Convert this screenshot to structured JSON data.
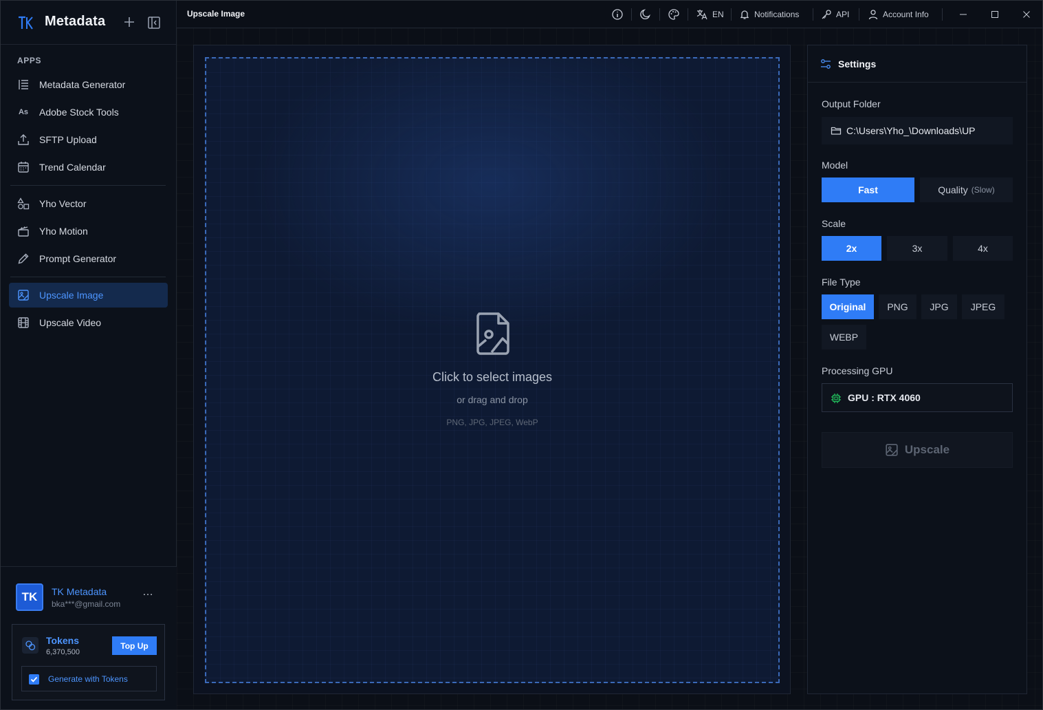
{
  "app": {
    "name": "Metadata",
    "page_title": "Upscale Image"
  },
  "sidebar": {
    "section_label": "APPS",
    "items": [
      {
        "label": "Metadata Generator",
        "icon": "list-icon"
      },
      {
        "label": "Adobe Stock Tools",
        "icon": "adobe-stock-icon",
        "icon_text": "As"
      },
      {
        "label": "SFTP Upload",
        "icon": "upload-icon"
      },
      {
        "label": "Trend Calendar",
        "icon": "calendar-icon"
      },
      {
        "label": "Yho Vector",
        "icon": "shapes-icon"
      },
      {
        "label": "Yho Motion",
        "icon": "clapperboard-icon"
      },
      {
        "label": "Prompt Generator",
        "icon": "pencil-icon"
      },
      {
        "label": "Upscale Image",
        "icon": "image-upscale-icon",
        "active": true
      },
      {
        "label": "Upscale Video",
        "icon": "film-icon"
      }
    ]
  },
  "user": {
    "initials": "TK",
    "name": "TK Metadata",
    "email": "bka***@gmail.com",
    "more": "…"
  },
  "tokens": {
    "title": "Tokens",
    "count": "6,370,500",
    "topup_label": "Top Up",
    "generate_label": "Generate with Tokens",
    "generate_checked": true
  },
  "topbar": {
    "language": "EN",
    "notifications": "Notifications",
    "api": "API",
    "account": "Account Info"
  },
  "dropzone": {
    "title": "Click to select images",
    "subtitle": "or drag and drop",
    "types": "PNG, JPG, JPEG, WebP"
  },
  "settings": {
    "title": "Settings",
    "output_folder_label": "Output Folder",
    "output_folder": "C:\\Users\\Yho_\\Downloads\\UP",
    "model_label": "Model",
    "models": [
      {
        "label": "Fast",
        "note": "",
        "selected": true
      },
      {
        "label": "Quality",
        "note": "(Slow)",
        "selected": false
      }
    ],
    "scale_label": "Scale",
    "scales": [
      {
        "label": "2x",
        "selected": true
      },
      {
        "label": "3x",
        "selected": false
      },
      {
        "label": "4x",
        "selected": false
      }
    ],
    "file_type_label": "File Type",
    "file_types": [
      {
        "label": "Original",
        "selected": true
      },
      {
        "label": "PNG",
        "selected": false
      },
      {
        "label": "JPG",
        "selected": false
      },
      {
        "label": "JPEG",
        "selected": false
      },
      {
        "label": "WEBP",
        "selected": false
      }
    ],
    "gpu_label": "Processing GPU",
    "gpu": "GPU : RTX 4060",
    "upscale_label": "Upscale"
  },
  "colors": {
    "accent": "#2f7cf6",
    "accent_text": "#4d95ff",
    "background": "#0b0f17",
    "gpu_icon": "#22c55e"
  }
}
